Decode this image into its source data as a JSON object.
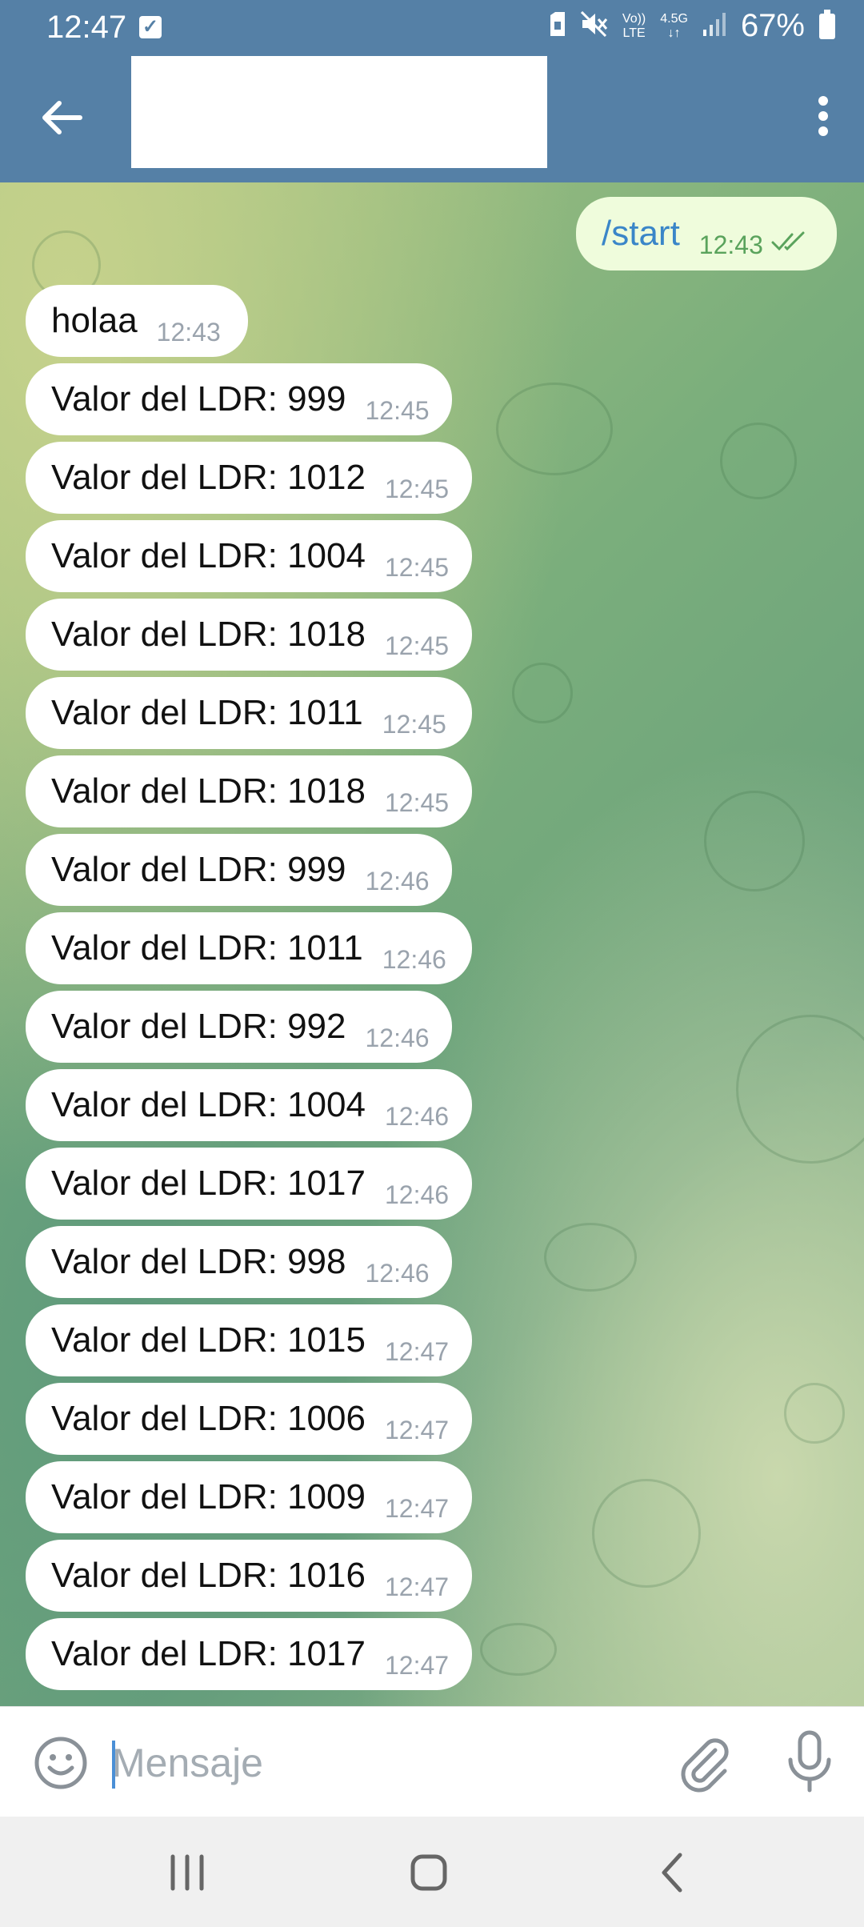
{
  "status_bar": {
    "time": "12:47",
    "network_top": "Vo))",
    "network_bottom": "LTE",
    "data_top": "4.5G",
    "battery": "67%"
  },
  "header": {
    "title": ""
  },
  "chat": {
    "outgoing": {
      "text": "/start",
      "time": "12:43"
    },
    "incoming": [
      {
        "text": "holaa",
        "time": "12:43"
      },
      {
        "text": "Valor del LDR: 999",
        "time": "12:45"
      },
      {
        "text": "Valor del LDR: 1012",
        "time": "12:45"
      },
      {
        "text": "Valor del LDR: 1004",
        "time": "12:45"
      },
      {
        "text": "Valor del LDR: 1018",
        "time": "12:45"
      },
      {
        "text": "Valor del LDR: 1011",
        "time": "12:45"
      },
      {
        "text": "Valor del LDR: 1018",
        "time": "12:45"
      },
      {
        "text": "Valor del LDR: 999",
        "time": "12:46"
      },
      {
        "text": "Valor del LDR: 1011",
        "time": "12:46"
      },
      {
        "text": "Valor del LDR: 992",
        "time": "12:46"
      },
      {
        "text": "Valor del LDR: 1004",
        "time": "12:46"
      },
      {
        "text": "Valor del LDR: 1017",
        "time": "12:46"
      },
      {
        "text": "Valor del LDR: 998",
        "time": "12:46"
      },
      {
        "text": "Valor del LDR: 1015",
        "time": "12:47"
      },
      {
        "text": "Valor del LDR: 1006",
        "time": "12:47"
      },
      {
        "text": "Valor del LDR: 1009",
        "time": "12:47"
      },
      {
        "text": "Valor del LDR: 1016",
        "time": "12:47"
      },
      {
        "text": "Valor del LDR: 1017",
        "time": "12:47"
      }
    ]
  },
  "input": {
    "placeholder": "Mensaje",
    "value": ""
  },
  "colors": {
    "header": "#5580a6",
    "outgoing_bubble": "#effcdc",
    "incoming_bubble": "#ffffff",
    "timestamp": "#9aa3ad"
  }
}
